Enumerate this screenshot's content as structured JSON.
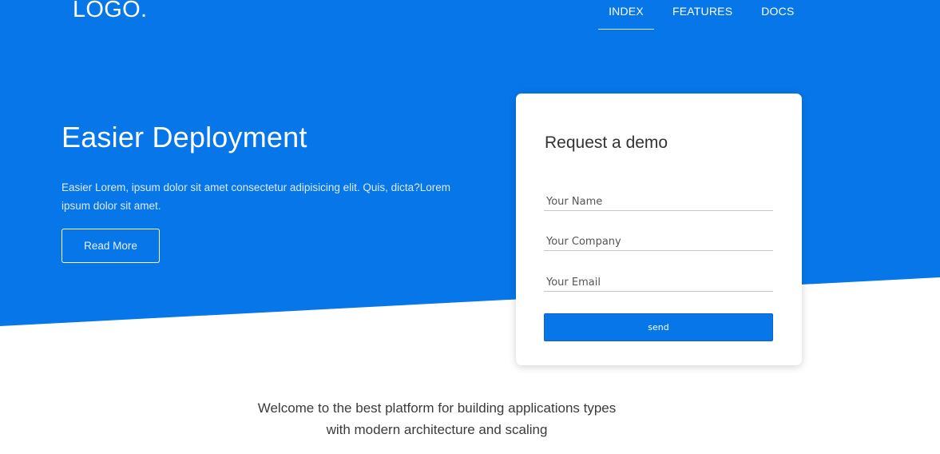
{
  "header": {
    "logo": "LOGO.",
    "nav": {
      "index": "INDEX",
      "features": "FEATURES",
      "docs": "DOCS"
    }
  },
  "hero": {
    "title": "Easier Deployment",
    "text": "Easier Lorem, ipsum dolor sit amet consectetur adipisicing elit. Quis, dicta?Lorem ipsum dolor sit amet.",
    "read_more_label": "Read More"
  },
  "demo_form": {
    "title": "Request a demo",
    "name_placeholder": "Your Name",
    "company_placeholder": "Your Company",
    "email_placeholder": "Your Email",
    "send_label": "send"
  },
  "welcome": {
    "line1": "Welcome to the best platform for building applications types",
    "line2": "with modern architecture and scaling"
  },
  "colors": {
    "brand_blue": "#0776e9",
    "text_dark": "#333333"
  }
}
